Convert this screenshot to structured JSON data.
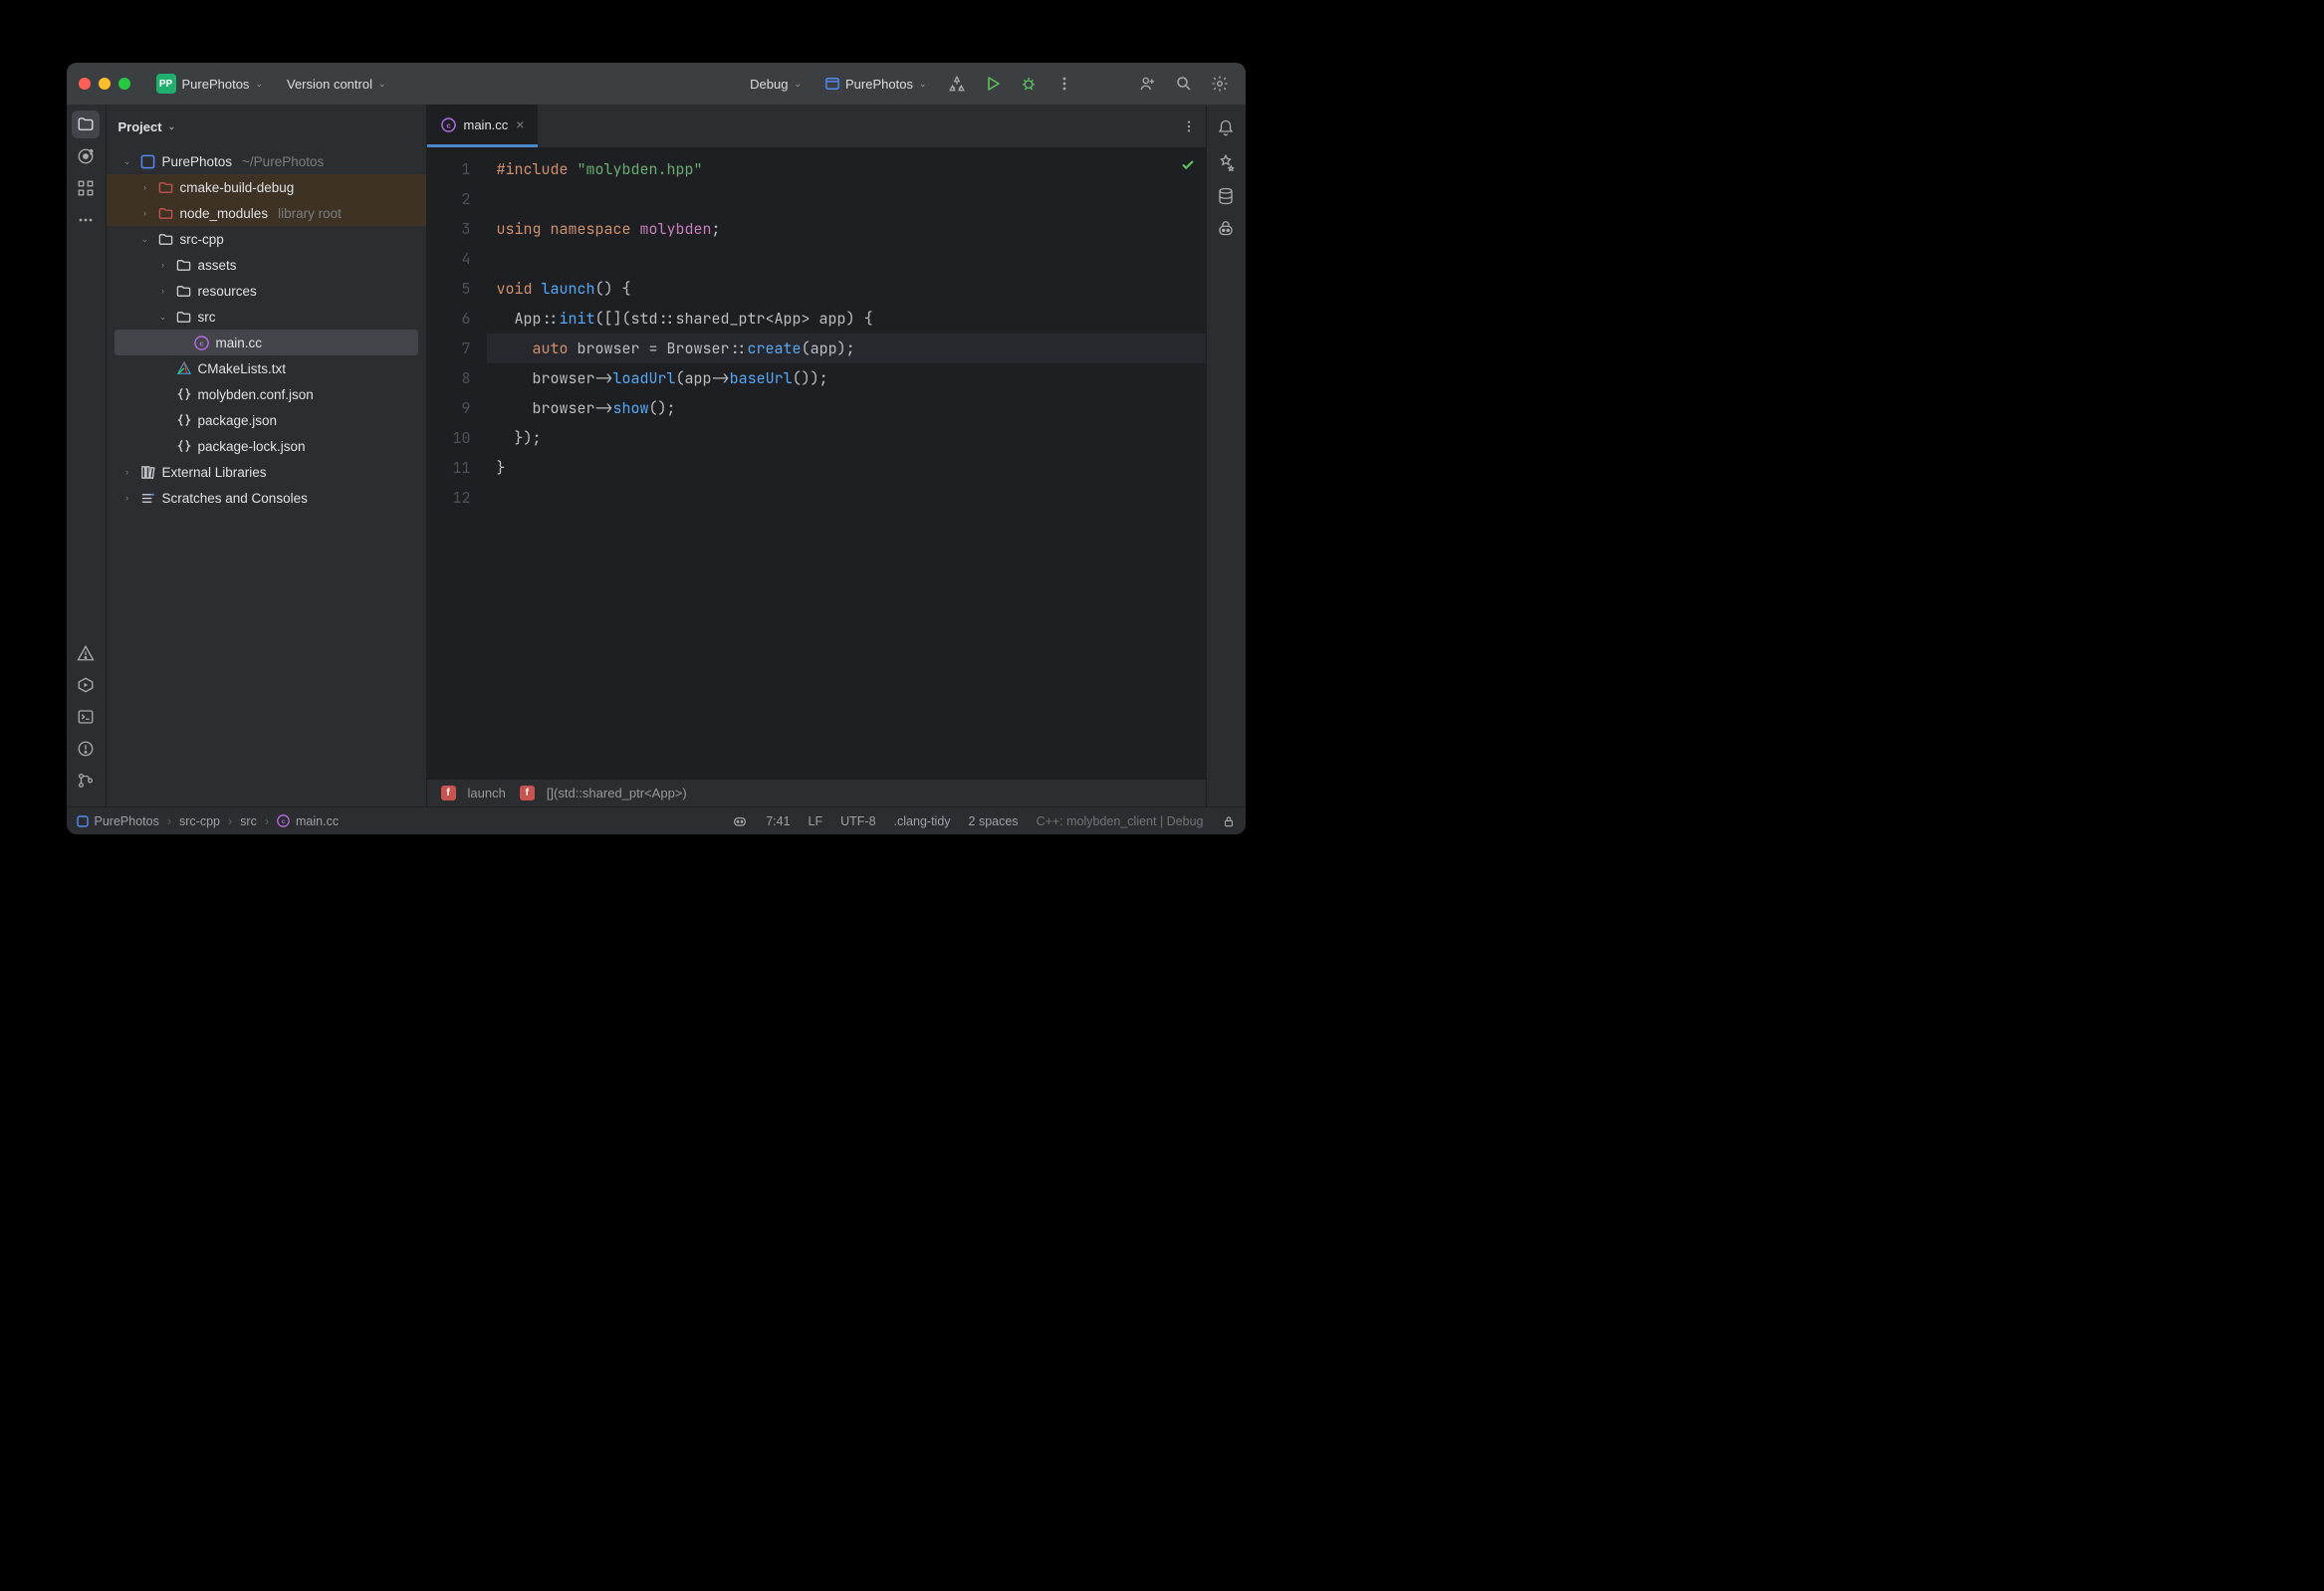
{
  "titlebar": {
    "project_badge": "PP",
    "project_name": "PurePhotos",
    "vcs_label": "Version control",
    "run_config": "Debug",
    "run_target_name": "PurePhotos"
  },
  "sidebar": {
    "header": "Project",
    "rows": [
      {
        "label": "PurePhotos",
        "suffix": "~/PurePhotos",
        "depth": 0,
        "expanded": true,
        "kind": "root"
      },
      {
        "label": "cmake-build-debug",
        "depth": 1,
        "expanded": false,
        "kind": "folder-exclude",
        "highlight": true
      },
      {
        "label": "node_modules",
        "suffix": "library root",
        "depth": 1,
        "expanded": false,
        "kind": "folder-exclude",
        "highlight": true
      },
      {
        "label": "src-cpp",
        "depth": 1,
        "expanded": true,
        "kind": "folder"
      },
      {
        "label": "assets",
        "depth": 2,
        "expanded": false,
        "kind": "folder"
      },
      {
        "label": "resources",
        "depth": 2,
        "expanded": false,
        "kind": "folder"
      },
      {
        "label": "src",
        "depth": 2,
        "expanded": true,
        "kind": "folder"
      },
      {
        "label": "main.cc",
        "depth": 3,
        "kind": "cpp",
        "selected": true
      },
      {
        "label": "CMakeLists.txt",
        "depth": 2,
        "kind": "cmake"
      },
      {
        "label": "molybden.conf.json",
        "depth": 2,
        "kind": "json"
      },
      {
        "label": "package.json",
        "depth": 2,
        "kind": "json"
      },
      {
        "label": "package-lock.json",
        "depth": 2,
        "kind": "json"
      },
      {
        "label": "External Libraries",
        "depth": 0,
        "expanded": false,
        "kind": "ext"
      },
      {
        "label": "Scratches and Consoles",
        "depth": 0,
        "expanded": false,
        "kind": "scratch"
      }
    ]
  },
  "tabs": {
    "active": {
      "label": "main.cc"
    }
  },
  "editor": {
    "line_count": 12,
    "highlight_line": 7
  },
  "code_tokens": [
    [
      {
        "t": "#include ",
        "c": "tok-kw"
      },
      {
        "t": "\"molybden.hpp\"",
        "c": "tok-str"
      }
    ],
    [
      {
        "t": "",
        "c": ""
      }
    ],
    [
      {
        "t": "using namespace ",
        "c": "tok-kw"
      },
      {
        "t": "molybden",
        "c": "tok-ns"
      },
      {
        "t": ";",
        "c": ""
      }
    ],
    [
      {
        "t": "",
        "c": ""
      }
    ],
    [
      {
        "t": "void ",
        "c": "tok-kw"
      },
      {
        "t": "launch",
        "c": "tok-fn"
      },
      {
        "t": "() {",
        "c": ""
      }
    ],
    [
      {
        "t": "  App::",
        "c": ""
      },
      {
        "t": "init",
        "c": "tok-fn"
      },
      {
        "t": "([](std::shared_ptr<App> ",
        "c": ""
      },
      {
        "t": "app",
        "c": "tok-param"
      },
      {
        "t": ") {",
        "c": ""
      }
    ],
    [
      {
        "t": "    ",
        "c": ""
      },
      {
        "t": "auto ",
        "c": "tok-kw"
      },
      {
        "t": "browser = Browser::",
        "c": ""
      },
      {
        "t": "create",
        "c": "tok-fn"
      },
      {
        "t": "(",
        "c": ""
      },
      {
        "t": "app",
        "c": "tok-param"
      },
      {
        "t": ");",
        "c": ""
      }
    ],
    [
      {
        "t": "    browser->",
        "c": ""
      },
      {
        "t": "loadUrl",
        "c": "tok-fn"
      },
      {
        "t": "(",
        "c": ""
      },
      {
        "t": "app",
        "c": "tok-param"
      },
      {
        "t": "->",
        "c": ""
      },
      {
        "t": "baseUrl",
        "c": "tok-fn"
      },
      {
        "t": "());",
        "c": ""
      }
    ],
    [
      {
        "t": "    browser->",
        "c": ""
      },
      {
        "t": "show",
        "c": "tok-fn"
      },
      {
        "t": "();",
        "c": ""
      }
    ],
    [
      {
        "t": "  });",
        "c": ""
      }
    ],
    [
      {
        "t": "}",
        "c": ""
      }
    ],
    [
      {
        "t": "",
        "c": ""
      }
    ]
  ],
  "fn_breadcrumb": {
    "items": [
      "launch",
      "[](std::shared_ptr<App>)"
    ]
  },
  "statusbar": {
    "crumbs": [
      "PurePhotos",
      "src-cpp",
      "src",
      "main.cc"
    ],
    "cursor": "7:41",
    "line_sep": "LF",
    "encoding": "UTF-8",
    "lint": ".clang-tidy",
    "indent": "2 spaces",
    "context": "C++: molybden_client | Debug"
  }
}
